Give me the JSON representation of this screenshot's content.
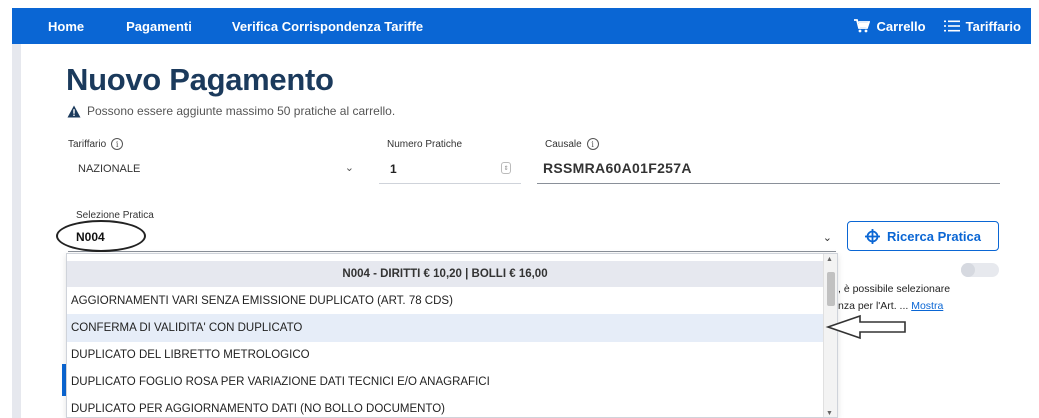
{
  "nav": {
    "links": [
      "Home",
      "Pagamenti",
      "Verifica Corrispondenza Tariffe"
    ],
    "cart_label": "Carrello",
    "tariffario_label": "Tariffario",
    "bg_color": "#0a66d4"
  },
  "page": {
    "title": "Nuovo Pagamento",
    "warning": "Possono essere aggiunte massimo 50 pratiche al carrello."
  },
  "form": {
    "tariffario": {
      "label": "Tariffario",
      "value": "NAZIONALE"
    },
    "numero_pratiche": {
      "label": "Numero Pratiche",
      "value": "1"
    },
    "causale": {
      "label": "Causale",
      "value": "RSSMRA60A01F257A"
    },
    "selezione_pratica": {
      "label": "Selezione Pratica",
      "value": "N004"
    },
    "ricerca_button": "Ricerca Pratica"
  },
  "dropdown": {
    "header": "N004 - DIRITTI € 10,20 | BOLLI € 16,00",
    "items": [
      "AGGIORNAMENTI VARI SENZA EMISSIONE DUPLICATO (ART. 78 CDS)",
      "CONFERMA DI VALIDITA' CON DUPLICATO",
      "DUPLICATO DEL LIBRETTO METROLOGICO",
      "DUPLICATO FOGLIO ROSA PER VARIAZIONE DATI TECNICI E/O ANAGRAFICI",
      "DUPLICATO PER AGGIORNAMENTO DATI (NO BOLLO DOCUMENTO)"
    ],
    "active_index": 1
  },
  "right_panel": {
    "line1": ", è possibile selezionare",
    "line2_prefix": "nza per l'Art. ...",
    "line2_link": "Mostra"
  }
}
